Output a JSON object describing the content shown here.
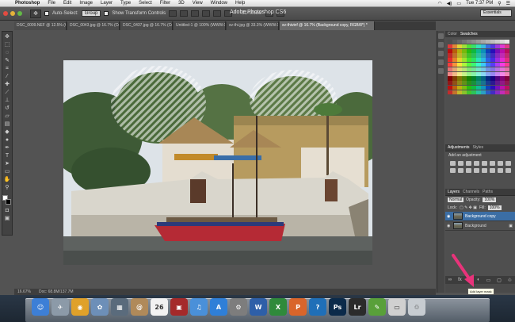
{
  "menubar": {
    "app": "Photoshop",
    "items": [
      "File",
      "Edit",
      "Image",
      "Layer",
      "Type",
      "Select",
      "Filter",
      "3D",
      "View",
      "Window",
      "Help"
    ],
    "clock": "Tue 7:37 PM"
  },
  "window": {
    "title": "Adobe Photoshop CS6"
  },
  "options": {
    "auto_select_label": "Auto-Select:",
    "auto_select_value": "Group",
    "transform_label": "Show Transform Controls",
    "mode3d_label": "3D Mode:",
    "workspace": "Essentials"
  },
  "tabs": [
    {
      "label": "DSC_0009.NEF @ 12.5% (Curves..."
    },
    {
      "label": "DSC_0043.jpg @ 16.7% (Curve..."
    },
    {
      "label": "DSC_0437.jpg @ 16.7% (Curves..."
    },
    {
      "label": "Untitled-1 @ 100% (WWW.CRAFT..."
    },
    {
      "label": "sv-thi.jpg @ 33.3% (WWW.CRAFT..."
    },
    {
      "label": "sv-thivinf @ 16.7% (Background copy, RGB/8*) *",
      "active": true
    }
  ],
  "status": {
    "zoom": "16.67%",
    "doc": "Doc: 68.8M/137.7M"
  },
  "panels": {
    "top_tabs": [
      "Color",
      "Swatches"
    ],
    "adjust_tabs": [
      "Adjustments",
      "Styles"
    ],
    "adjust_title": "Add an adjustment",
    "layer_tabs": [
      "Layers",
      "Channels",
      "Paths"
    ],
    "blend_mode": "Normal",
    "opacity_label": "Opacity:",
    "opacity_value": "100%",
    "lock_label": "Lock:",
    "fill_label": "Fill:",
    "fill_value": "100%",
    "layers": [
      {
        "name": "Background copy",
        "selected": true
      },
      {
        "name": "Background",
        "locked": true
      }
    ],
    "tooltip": "Add layer mask"
  },
  "dock": {
    "items": [
      {
        "icon": "finder-icon",
        "color": "#3d7fd6",
        "glyph": "☺"
      },
      {
        "icon": "launchpad-icon",
        "color": "#8c9aa8",
        "glyph": "✈"
      },
      {
        "icon": "chrome-icon",
        "color": "#e0a12a",
        "glyph": "◉"
      },
      {
        "icon": "iphoto-icon",
        "color": "#6d8fb8",
        "glyph": "✿"
      },
      {
        "icon": "photos-icon",
        "color": "#5a6b7c",
        "glyph": "▦"
      },
      {
        "icon": "addressbook-icon",
        "color": "#b08a5a",
        "glyph": "@"
      },
      {
        "icon": "calendar-icon",
        "color": "#f2f2f2",
        "glyph": "26"
      },
      {
        "icon": "photobooth-icon",
        "color": "#a52a2a",
        "glyph": "▣"
      },
      {
        "icon": "itunes-icon",
        "color": "#4a90d9",
        "glyph": "♫"
      },
      {
        "icon": "appstore-icon",
        "color": "#2f7fd8",
        "glyph": "A"
      },
      {
        "icon": "syspref-icon",
        "color": "#7d7d7d",
        "glyph": "⚙"
      },
      {
        "icon": "word-icon",
        "color": "#2e5fa8",
        "glyph": "W"
      },
      {
        "icon": "excel-icon",
        "color": "#2f8a3b",
        "glyph": "X"
      },
      {
        "icon": "powerpoint-icon",
        "color": "#d9652b",
        "glyph": "P"
      },
      {
        "icon": "outlook-icon",
        "color": "#1f6fb8",
        "glyph": "?"
      },
      {
        "icon": "photoshop-icon",
        "color": "#0b2a4a",
        "glyph": "Ps"
      },
      {
        "icon": "lightroom-icon",
        "color": "#2b2b2b",
        "glyph": "Lr"
      },
      {
        "icon": "evernote-icon",
        "color": "#59a03a",
        "glyph": "✎"
      },
      {
        "icon": "screenshot-icon",
        "color": "#d0d0d0",
        "glyph": "▭"
      },
      {
        "icon": "trash-icon",
        "color": "#c7ccd1",
        "glyph": "♲"
      }
    ]
  }
}
